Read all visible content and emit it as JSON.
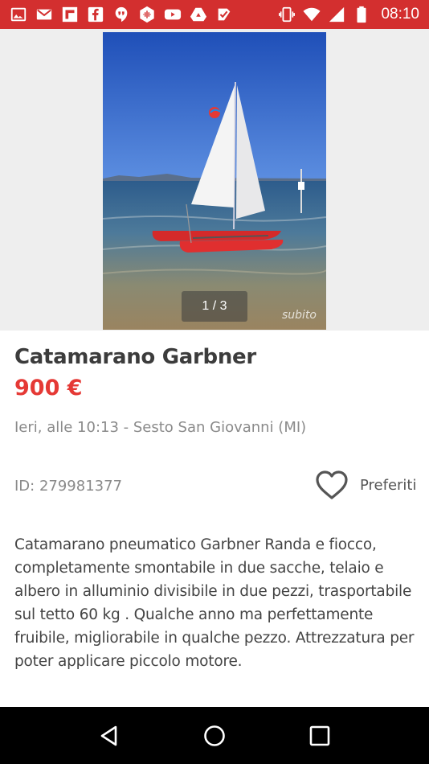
{
  "status_bar": {
    "time": "08:10",
    "icons": [
      "image-icon",
      "gmail-icon",
      "flipboard-icon",
      "facebook-icon",
      "hangouts-icon",
      "podcast-icon",
      "youtube-icon",
      "drive-icon",
      "tasks-icon",
      "vibrate-icon",
      "wifi-icon",
      "signal-icon",
      "battery-icon"
    ],
    "background_color": "#d32f2f"
  },
  "gallery": {
    "counter": "1 / 3",
    "watermark": "subito"
  },
  "listing": {
    "title": "Catamarano Garbner",
    "price": "900 €",
    "meta": "Ieri, alle 10:13 - Sesto San Giovanni (MI)",
    "id_text": "ID: 279981377",
    "favorite_label": "Preferiti",
    "description": "Catamarano pneumatico Garbner Randa e fiocco, completamente smontabile in due sacche, telaio e albero in alluminio divisibile in due pezzi, trasportabile sul tetto 60 kg . Qualche anno ma perfettamente fruibile, migliorabile in qualche pezzo. Attrezzatura per poter applicare piccolo motore."
  },
  "colors": {
    "accent": "#e53935",
    "title": "#3c3c3c",
    "secondary_text": "#8a8a8a"
  },
  "nav_bar": {
    "buttons": [
      "back-icon",
      "home-icon",
      "recents-icon"
    ]
  }
}
